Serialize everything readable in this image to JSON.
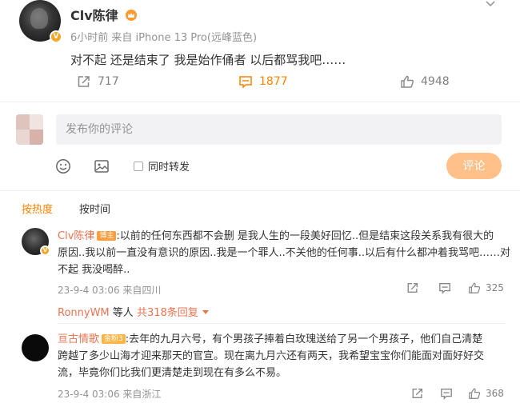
{
  "post": {
    "author": "Clv陈律",
    "time": "6小时前",
    "source": "来自 iPhone 13 Pro(远峰蓝色)",
    "text": "对不起 还是结束了 我是始作俑者 以后都骂我吧……",
    "reposts": "717",
    "comments": "1877",
    "likes": "4948"
  },
  "composer": {
    "placeholder": "发布你的评论",
    "also_repost_label": "同时转发",
    "submit_label": "评论"
  },
  "sort_tabs": {
    "hot": "按热度",
    "time": "按时间"
  },
  "comments": [
    {
      "author": "Clv陈律",
      "tag": "博主",
      "line1": ":以前的任何东西都不会删 是我人生的一段美好回忆..但是结束这段关系我有很大的",
      "line2": "原因..我以前一直没有意识的原因..我是一个罪人..不关他的任何事..以后有什么都冲着我骂吧……对",
      "line3": "不起 我没喝醉..",
      "time": "23-9-4 03:06 来自四川",
      "likes": "325",
      "reply_author": "RonnyWM",
      "reply_etc": "等人",
      "reply_count": "共318条回复"
    },
    {
      "author": "亘古情歌",
      "tag": "金粉3",
      "line1": ":去年的九月六号，有个男孩子捧着白玫瑰送给了另一个男孩子，他们自己清楚",
      "line2": "跨越了多少山海才迎来那天的官宣。现在离九月六还有两天，我希望宝宝你们能面对面好好交",
      "line3": "流，毕竟你们比我们更清楚走到现在有多么不易。",
      "time": "23-9-4 03:06 来自浙江",
      "likes": "368"
    }
  ],
  "colors": {
    "accent": "#ff8200",
    "name": "#eb7350",
    "submit": "#ffc08a"
  }
}
